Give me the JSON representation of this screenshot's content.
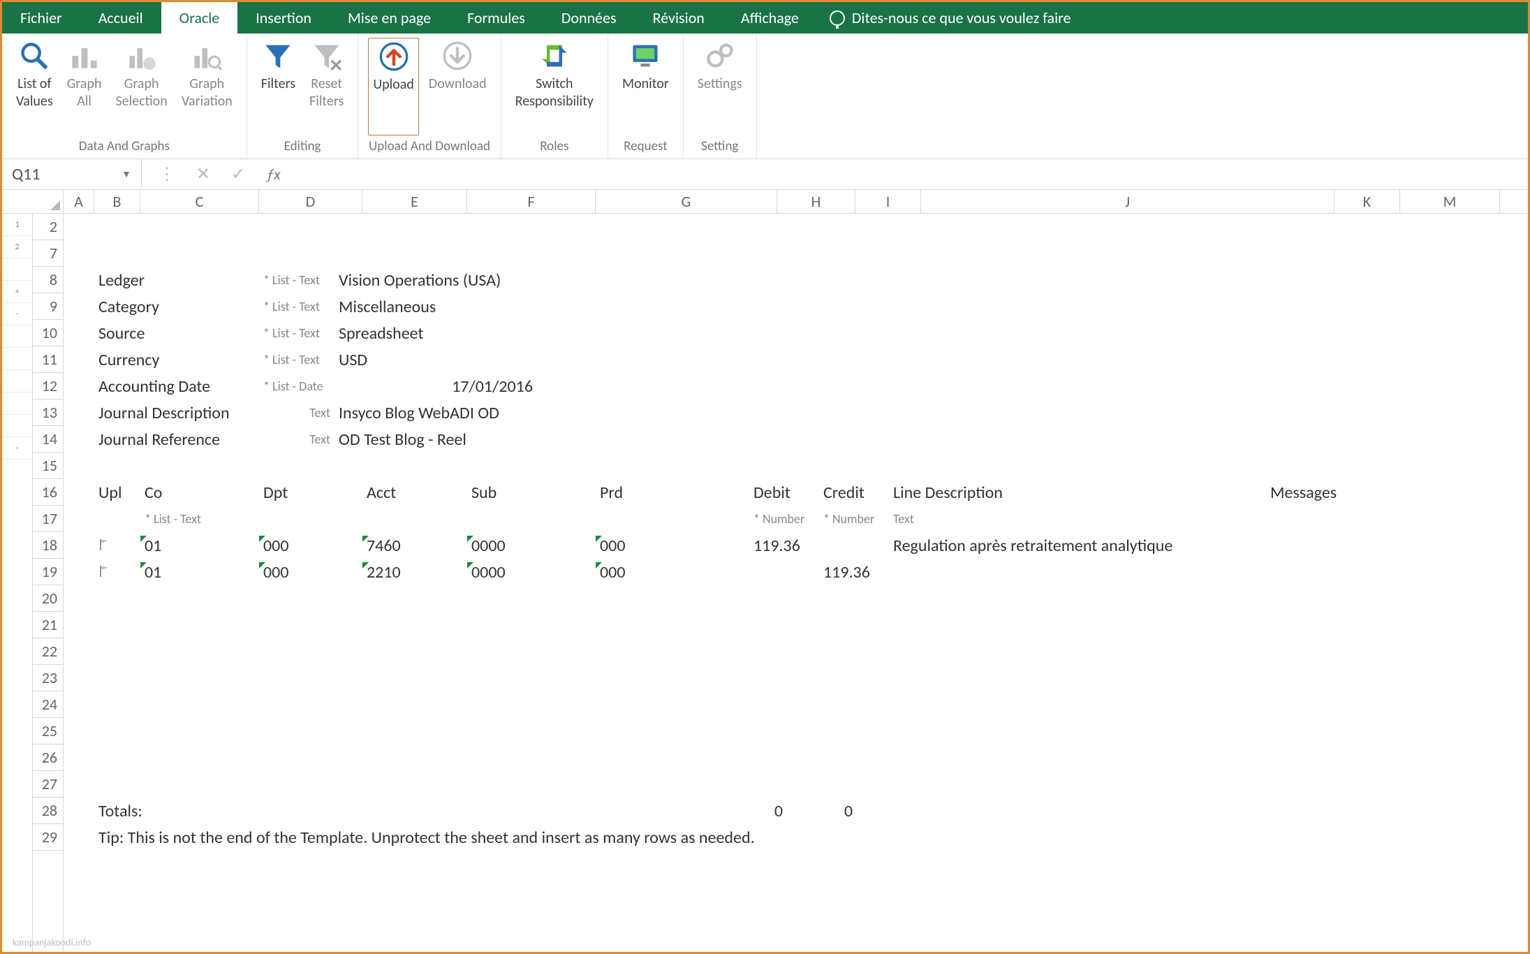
{
  "menubar": {
    "tabs": [
      "Fichier",
      "Accueil",
      "Oracle",
      "Insertion",
      "Mise en page",
      "Formules",
      "Données",
      "Révision",
      "Affichage"
    ],
    "active_index": 2,
    "tell_me": "Dites-nous ce que vous voulez faire"
  },
  "ribbon": {
    "groups": [
      {
        "label": "Data And Graphs",
        "items": [
          {
            "name": "list-of-values",
            "l1": "List of",
            "l2": "Values",
            "dark": true
          },
          {
            "name": "graph-all",
            "l1": "Graph",
            "l2": "All"
          },
          {
            "name": "graph-selection",
            "l1": "Graph",
            "l2": "Selection"
          },
          {
            "name": "graph-variation",
            "l1": "Graph",
            "l2": "Variation"
          }
        ]
      },
      {
        "label": "Editing",
        "items": [
          {
            "name": "filters",
            "l1": "Filters",
            "l2": "",
            "dark": true
          },
          {
            "name": "reset-filters",
            "l1": "Reset",
            "l2": "Filters"
          }
        ]
      },
      {
        "label": "Upload And Download",
        "items": [
          {
            "name": "upload",
            "l1": "Upload",
            "l2": "",
            "dark": true,
            "selected": true
          },
          {
            "name": "download",
            "l1": "Download",
            "l2": ""
          }
        ]
      },
      {
        "label": "Roles",
        "items": [
          {
            "name": "switch-responsibility",
            "l1": "Switch",
            "l2": "Responsibility",
            "dark": true
          }
        ]
      },
      {
        "label": "Request",
        "items": [
          {
            "name": "monitor",
            "l1": "Monitor",
            "l2": "",
            "dark": true
          }
        ]
      },
      {
        "label": "Setting",
        "items": [
          {
            "name": "settings",
            "l1": "Settings",
            "l2": ""
          }
        ]
      }
    ]
  },
  "namebox": "Q11",
  "columns": [
    "A",
    "B",
    "C",
    "D",
    "E",
    "F",
    "G",
    "H",
    "I",
    "J",
    "K",
    "M"
  ],
  "row_numbers": [
    "2",
    "7",
    "8",
    "9",
    "10",
    "11",
    "12",
    "13",
    "14",
    "15",
    "16",
    "17",
    "18",
    "19",
    "20",
    "21",
    "22",
    "23",
    "24",
    "25",
    "26",
    "27",
    "28",
    "29"
  ],
  "gutter": [
    "1",
    "2",
    "",
    "+",
    "-",
    "",
    "",
    "",
    "",
    "",
    "-",
    "",
    "",
    "",
    "",
    "",
    ""
  ],
  "header": {
    "rows": [
      {
        "label": "Ledger",
        "hint": "* List - Text",
        "value": "Vision Operations (USA)"
      },
      {
        "label": "Category",
        "hint": "* List - Text",
        "value": "Miscellaneous"
      },
      {
        "label": "Source",
        "hint": "* List - Text",
        "value": "Spreadsheet"
      },
      {
        "label": "Currency",
        "hint": "* List - Text",
        "value": "USD"
      },
      {
        "label": "Accounting Date",
        "hint": "* List - Date",
        "value": "17/01/2016",
        "date": true
      },
      {
        "label": "Journal Description",
        "hint": "Text",
        "value": "Insyco Blog WebADI OD"
      },
      {
        "label": "Journal Reference",
        "hint": "Text",
        "value": "OD Test Blog - Reel"
      }
    ]
  },
  "table": {
    "cols": [
      "Upl",
      "Co",
      "Dpt",
      "Acct",
      "Sub",
      "Prd",
      "Debit",
      "Credit",
      "Line Description",
      "Messages"
    ],
    "hints": [
      "",
      "* List - Text",
      "",
      "",
      "",
      "",
      "* Number",
      "* Number",
      "Text",
      ""
    ],
    "rows": [
      {
        "upl": true,
        "co": "01",
        "dpt": "000",
        "acct": "7460",
        "sub": "0000",
        "prd": "000",
        "debit": "119.36",
        "credit": "",
        "desc": "Regulation après retraitement analytique"
      },
      {
        "upl": true,
        "co": "01",
        "dpt": "000",
        "acct": "2210",
        "sub": "0000",
        "prd": "000",
        "debit": "",
        "credit": "119.36",
        "desc": ""
      }
    ],
    "totals": {
      "label": "Totals:",
      "debit": "0",
      "credit": "0"
    },
    "tip": "Tip: This is not the end of the Template.  Unprotect the sheet and insert as many rows as needed."
  },
  "watermark": "kampanjakoodi.info"
}
